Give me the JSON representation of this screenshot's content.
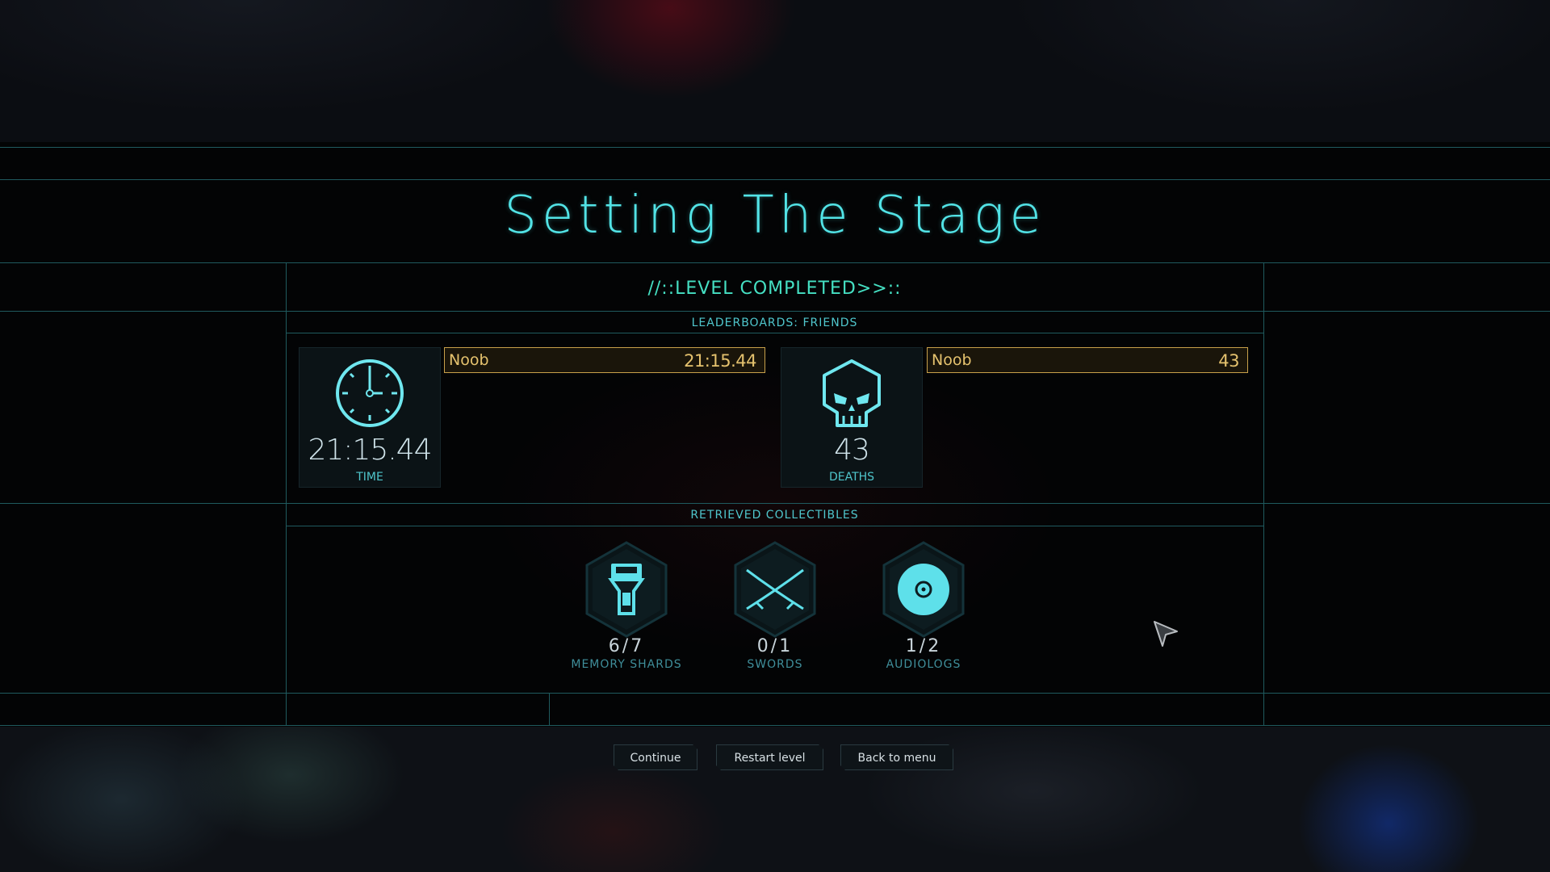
{
  "title": "Setting The Stage",
  "subtitle": "//::LEVEL COMPLETED>>::",
  "leaderboard_label": "LEADERBOARDS: FRIENDS",
  "collectibles_label": "RETRIEVED COLLECTIBLES",
  "stats": {
    "time": {
      "value": "21:15.44",
      "label": "TIME",
      "icon": "clock-icon"
    },
    "deaths": {
      "value": "43",
      "label": "DEATHS",
      "icon": "skull-icon"
    }
  },
  "leaderboard": {
    "time_entry": {
      "name": "Noob",
      "value": "21:15.44"
    },
    "deaths_entry": {
      "name": "Noob",
      "value": "43"
    }
  },
  "collectibles": [
    {
      "count": "6/7",
      "label": "MEMORY SHARDS",
      "icon": "memory-shard-icon"
    },
    {
      "count": "0/1",
      "label": "SWORDS",
      "icon": "crossed-swords-icon"
    },
    {
      "count": "1/2",
      "label": "AUDIOLOGS",
      "icon": "audiolog-disc-icon"
    }
  ],
  "buttons": {
    "continue": "Continue",
    "restart": "Restart level",
    "menu": "Back to menu"
  },
  "colors": {
    "accent": "#52e3e6",
    "gold": "#e5c26e",
    "line": "#1f5a5e"
  }
}
